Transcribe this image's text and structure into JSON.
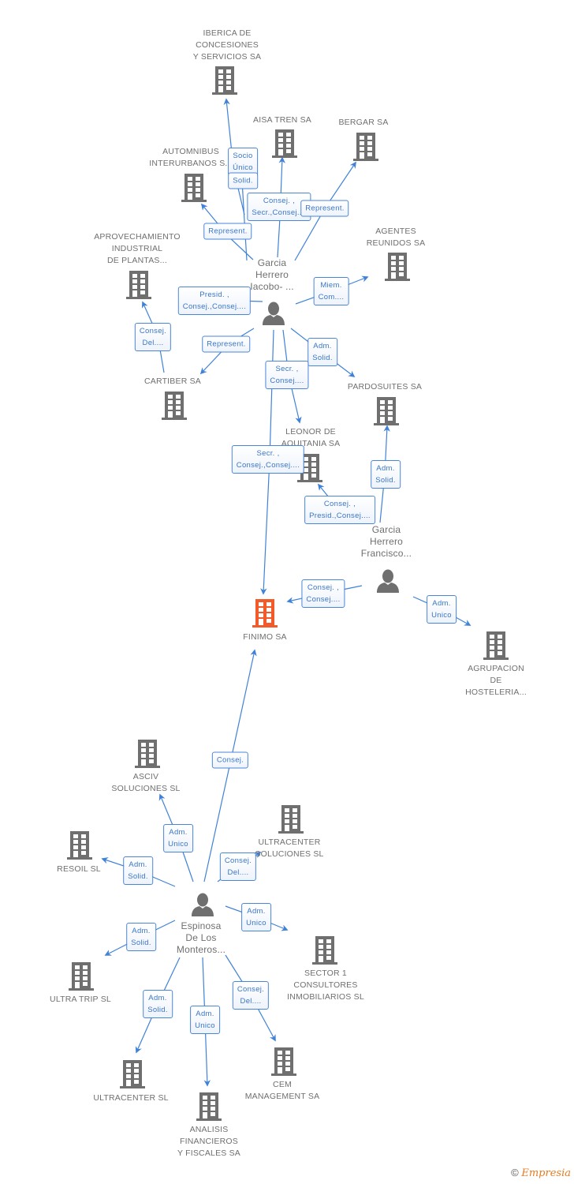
{
  "colors": {
    "company_icon": "#6f6f6f",
    "focus_company_icon": "#f25a29",
    "person_icon": "#6f6f6f",
    "edge_line": "#3f82d8",
    "edge_label_text": "#3a76c8",
    "label_text": "#6f6f6f"
  },
  "nodes": [
    {
      "id": "finimo",
      "type": "company",
      "focus": true,
      "label": "FINIMO SA"
    },
    {
      "id": "iberica",
      "type": "company",
      "label": "IBERICA DE\nCONCESIONES\nY SERVICIOS SA"
    },
    {
      "id": "aisa",
      "type": "company",
      "label": "AISA TREN SA"
    },
    {
      "id": "bergar",
      "type": "company",
      "label": "BERGAR SA"
    },
    {
      "id": "automnibus",
      "type": "company",
      "label": "AUTOMNIBUS\nINTERURBANOS S..."
    },
    {
      "id": "aprovechamiento",
      "type": "company",
      "label": "APROVECHAMIENTO\nINDUSTRIAL\nDE PLANTAS..."
    },
    {
      "id": "agentes",
      "type": "company",
      "label": "AGENTES\nREUNIDOS SA"
    },
    {
      "id": "cartiber",
      "type": "company",
      "label": "CARTIBER SA"
    },
    {
      "id": "pardosuites",
      "type": "company",
      "label": "PARDOSUITES SA"
    },
    {
      "id": "leonor",
      "type": "company",
      "label": "LEONOR DE\nAQUITANIA SA"
    },
    {
      "id": "agrupacion",
      "type": "company",
      "label": "AGRUPACION\nDE\nHOSTELERIA..."
    },
    {
      "id": "asciv",
      "type": "company",
      "label": "ASCIV\nSOLUCIONES SL"
    },
    {
      "id": "ultracenter_sol",
      "type": "company",
      "label": "ULTRACENTER\nSOLUCIONES SL"
    },
    {
      "id": "resoil",
      "type": "company",
      "label": "RESOIL SL"
    },
    {
      "id": "sector1",
      "type": "company",
      "label": "SECTOR 1\nCONSULTORES\nINMOBILIARIOS SL"
    },
    {
      "id": "ultratrip",
      "type": "company",
      "label": "ULTRA TRIP SL"
    },
    {
      "id": "ultracenter",
      "type": "company",
      "label": "ULTRACENTER SL"
    },
    {
      "id": "analisis",
      "type": "company",
      "label": "ANALISIS\nFINANCIEROS\nY FISCALES SA"
    },
    {
      "id": "cem",
      "type": "company",
      "label": "CEM\nMANAGEMENT SA"
    },
    {
      "id": "garcia_iacobo",
      "type": "person",
      "label": "Garcia\nHerrero\nIacobo- ..."
    },
    {
      "id": "garcia_francisco",
      "type": "person",
      "label": "Garcia\nHerrero\nFrancisco..."
    },
    {
      "id": "espinosa",
      "type": "person",
      "label": "Espinosa\nDe Los\nMonteros..."
    }
  ],
  "edges": [
    {
      "from": "garcia_iacobo",
      "to": "iberica",
      "label": "Socio\nÚnico"
    },
    {
      "from": "garcia_iacobo",
      "to": "automnibus_solid",
      "label": "Solid."
    },
    {
      "from": "garcia_iacobo",
      "to": "aisa",
      "label": "Consej. ,\nSecr.,Consej...."
    },
    {
      "from": "garcia_iacobo",
      "to": "bergar",
      "label": "Represent."
    },
    {
      "from": "garcia_iacobo",
      "to": "automnibus",
      "label": "Represent."
    },
    {
      "from": "garcia_iacobo",
      "to": "agentes",
      "label": "Miem.\nCom...."
    },
    {
      "from": "garcia_iacobo",
      "to": "aprovechamiento_presid",
      "label": "Presid. ,\nConsej.,Consej...."
    },
    {
      "from": "cartiber",
      "to": "aprovechamiento",
      "label": "Consej.\nDel...."
    },
    {
      "from": "garcia_iacobo",
      "to": "cartiber",
      "label": "Represent."
    },
    {
      "from": "garcia_iacobo",
      "to": "pardosuites",
      "label": "Adm.\nSolid."
    },
    {
      "from": "garcia_iacobo",
      "to": "leonor",
      "label": "Secr. ,\nConsej...."
    },
    {
      "from": "garcia_iacobo",
      "to": "finimo",
      "label": "Secr. ,\nConsej.,Consej...."
    },
    {
      "from": "garcia_francisco",
      "to": "leonor",
      "label": "Consej. ,\nPresid.,Consej...."
    },
    {
      "from": "garcia_francisco",
      "to": "pardosuites",
      "label": "Adm.\nSolid."
    },
    {
      "from": "garcia_francisco",
      "to": "finimo",
      "label": "Consej. ,\nConsej...."
    },
    {
      "from": "garcia_francisco",
      "to": "agrupacion",
      "label": "Adm.\nUnico"
    },
    {
      "from": "espinosa",
      "to": "finimo",
      "label": "Consej."
    },
    {
      "from": "espinosa",
      "to": "asciv",
      "label": "Adm.\nUnico"
    },
    {
      "from": "espinosa",
      "to": "ultracenter_sol",
      "label": "Consej.\nDel...."
    },
    {
      "from": "espinosa",
      "to": "resoil",
      "label": "Adm.\nSolid."
    },
    {
      "from": "espinosa",
      "to": "sector1",
      "label": "Adm.\nUnico"
    },
    {
      "from": "espinosa",
      "to": "ultratrip",
      "label": "Adm.\nSolid."
    },
    {
      "from": "espinosa",
      "to": "ultracenter",
      "label": "Adm.\nSolid."
    },
    {
      "from": "espinosa",
      "to": "analisis",
      "label": "Adm.\nUnico"
    },
    {
      "from": "espinosa",
      "to": "cem",
      "label": "Consej.\nDel...."
    }
  ],
  "footer": {
    "copyright": "©",
    "brand": "Empresia"
  }
}
